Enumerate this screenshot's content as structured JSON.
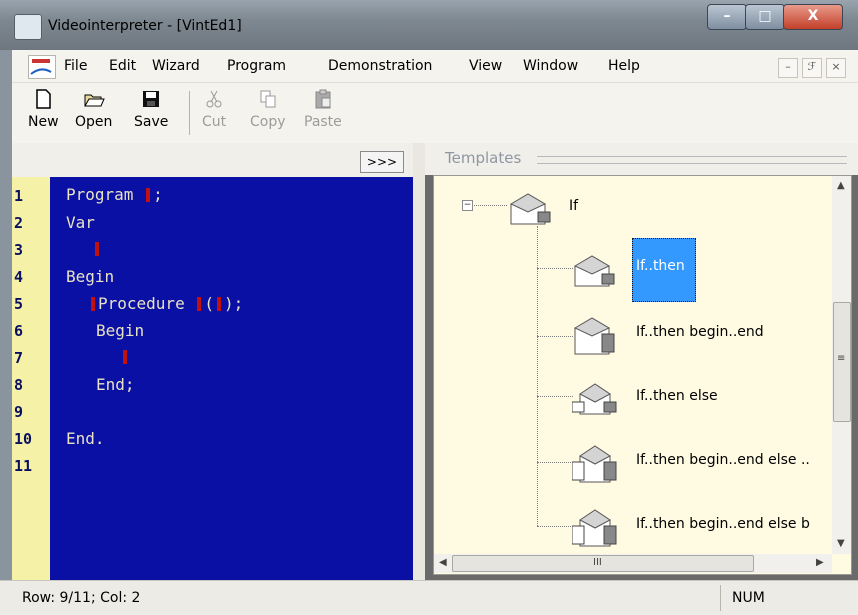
{
  "window": {
    "title": "Videointerpreter - [VintEd1]",
    "minimize": "–",
    "maximize": "□",
    "close": "X"
  },
  "menubar": {
    "items": [
      "File",
      "Edit",
      "Wizard",
      "Program",
      "Demonstration",
      "View",
      "Window",
      "Help"
    ],
    "mdi_minimize": "–",
    "mdi_restore": "ℱ",
    "mdi_close": "×"
  },
  "toolbar": {
    "new": "New",
    "open": "Open",
    "save": "Save",
    "cut": "Cut",
    "copy": "Copy",
    "paste": "Paste"
  },
  "left_pane": {
    "expand_button": ">>>"
  },
  "editor": {
    "line_numbers": [
      "1",
      "2",
      "3",
      "4",
      "5",
      "6",
      "7",
      "8",
      "9",
      "10",
      "11"
    ],
    "lines": {
      "l1": "Program",
      "l1b": ";",
      "l2": "Var",
      "l4": "Begin",
      "l5": "Procedure",
      "l5b": "(",
      "l5c": ");",
      "l6": "Begin",
      "l8": "End;",
      "l10": "End."
    },
    "background_color": "#0a10a4",
    "gutter_color": "#f5f2a8"
  },
  "templates": {
    "title": "Templates",
    "nodes": {
      "root": "If",
      "n1": "If..then",
      "n2": "If..then begin..end",
      "n3": "If..then else",
      "n4": "If..then begin..end else ..",
      "n5": "If..then begin..end else b"
    },
    "selected_node": "If..then",
    "selection_color": "#3399ff",
    "hscroll_grip": "III",
    "vscroll_grip": "≡"
  },
  "statusbar": {
    "position": "Row: 9/11; Col: 2",
    "num": "NUM"
  }
}
